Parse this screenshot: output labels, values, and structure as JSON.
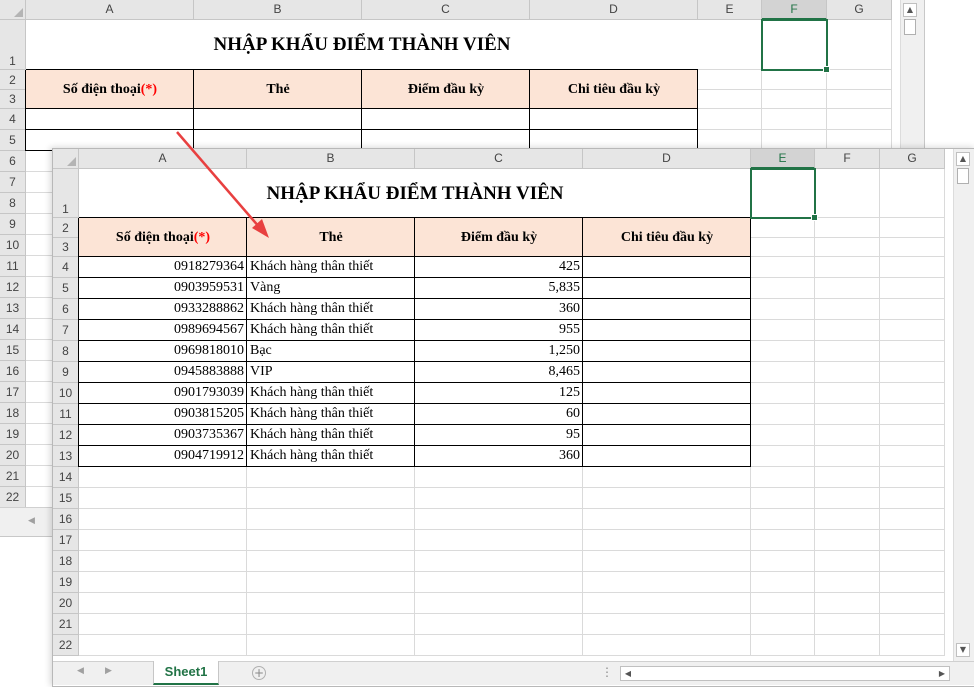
{
  "columns": [
    "A",
    "B",
    "C",
    "D",
    "E",
    "F",
    "G"
  ],
  "selected_column_back": "F",
  "selected_column_front": "E",
  "title": "NHẬP KHẨU ĐIỂM THÀNH VIÊN",
  "headers": {
    "phone": "Số điện thoại ",
    "required_mark": "(*)",
    "card": "Thẻ",
    "opening_points": "Điểm đầu kỳ",
    "opening_spend": "Chi tiêu đầu kỳ"
  },
  "back_row_numbers": [
    "1",
    "2",
    "3",
    "4",
    "5",
    "6",
    "7",
    "8",
    "9",
    "10",
    "11",
    "12",
    "13",
    "14",
    "15",
    "16",
    "17",
    "18",
    "19",
    "20",
    "21",
    "22"
  ],
  "front_row_numbers": [
    "1",
    "2",
    "3",
    "4",
    "5",
    "6",
    "7",
    "8",
    "9",
    "10",
    "11",
    "12",
    "13",
    "14",
    "15",
    "16",
    "17",
    "18",
    "19",
    "20",
    "21",
    "22"
  ],
  "rows": [
    {
      "phone": "0918279364",
      "card": "Khách hàng thân thiết",
      "points": "425",
      "spend": ""
    },
    {
      "phone": "0903959531",
      "card": "Vàng",
      "points": "5,835",
      "spend": ""
    },
    {
      "phone": "0933288862",
      "card": "Khách hàng thân thiết",
      "points": "360",
      "spend": ""
    },
    {
      "phone": "0989694567",
      "card": "Khách hàng thân thiết",
      "points": "955",
      "spend": ""
    },
    {
      "phone": "0969818010",
      "card": "Bạc",
      "points": "1,250",
      "spend": ""
    },
    {
      "phone": "0945883888",
      "card": "VIP",
      "points": "8,465",
      "spend": ""
    },
    {
      "phone": "0901793039",
      "card": "Khách hàng thân thiết",
      "points": "125",
      "spend": ""
    },
    {
      "phone": "0903815205",
      "card": "Khách hàng thân thiết",
      "points": "60",
      "spend": ""
    },
    {
      "phone": "0903735367",
      "card": "Khách hàng thân thiết",
      "points": "95",
      "spend": ""
    },
    {
      "phone": "0904719912",
      "card": "Khách hàng thân thiết",
      "points": "360",
      "spend": ""
    }
  ],
  "sheet_tab": "Sheet1",
  "colors": {
    "header_fill": "#fce4d6",
    "accent": "#217346",
    "required": "#ff0000",
    "arrow": "#e84040"
  },
  "icons": {
    "scroll_up": "scroll-up-icon",
    "scroll_down": "scroll-down-icon",
    "scroll_left": "scroll-left-icon",
    "scroll_right": "scroll-right-icon",
    "add_sheet": "plus-circle-icon"
  }
}
